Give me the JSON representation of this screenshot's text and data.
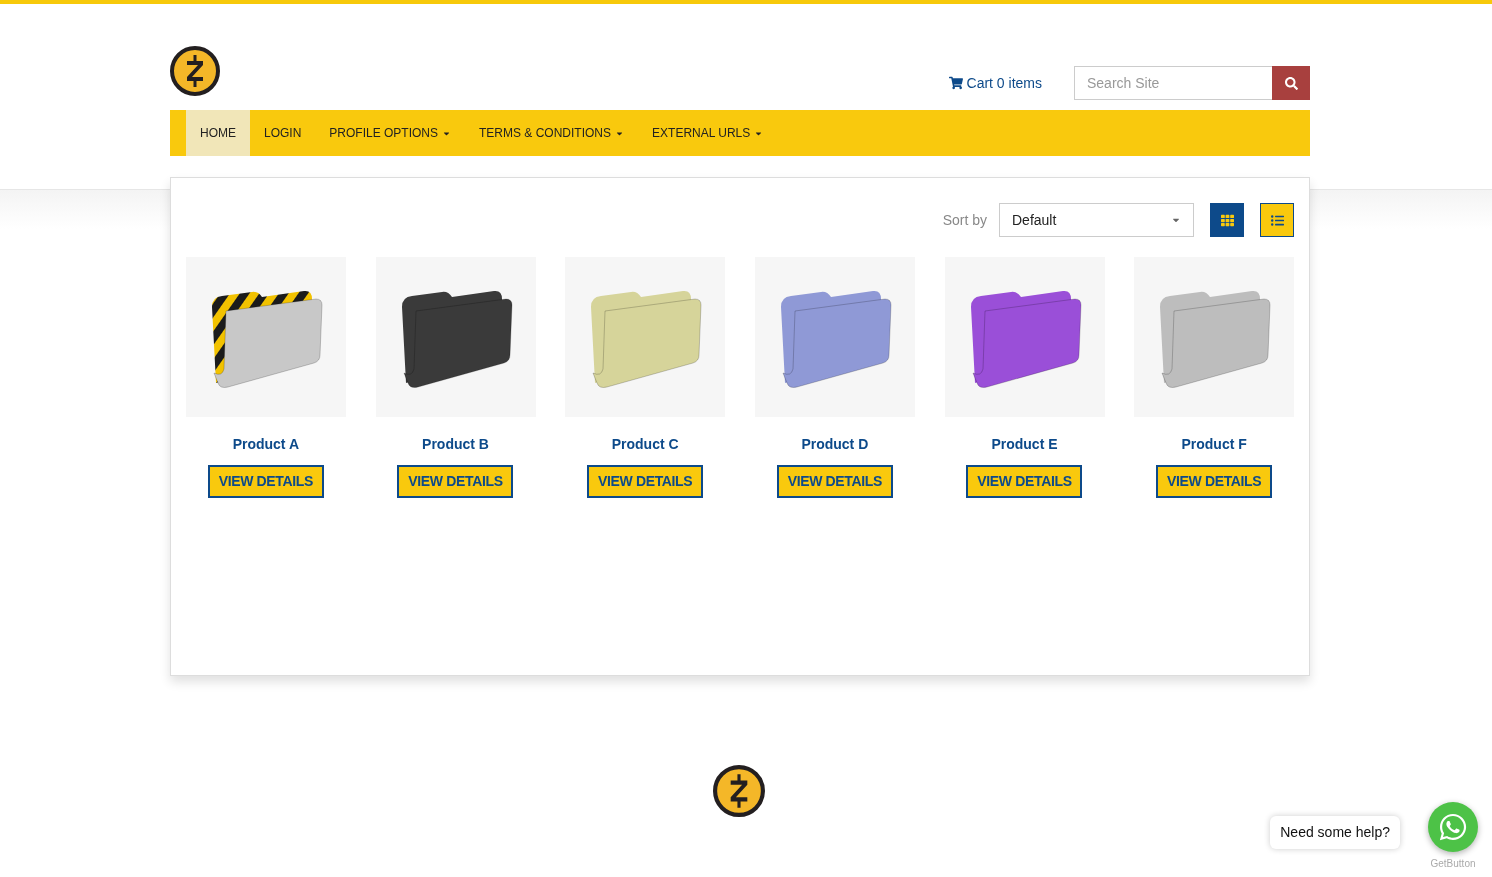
{
  "header": {
    "cart": "Cart 0 items",
    "search": {
      "placeholder": "Search Site"
    }
  },
  "nav": [
    {
      "label": "HOME",
      "selected": true,
      "dropdown": false
    },
    {
      "label": "LOGIN",
      "selected": false,
      "dropdown": false
    },
    {
      "label": "PROFILE OPTIONS",
      "selected": false,
      "dropdown": true
    },
    {
      "label": "TERMS & CONDITIONS",
      "selected": false,
      "dropdown": true
    },
    {
      "label": "EXTERNAL URLS",
      "selected": false,
      "dropdown": true
    }
  ],
  "toolbar": {
    "sort_label": "Sort by",
    "sort_value": "Default",
    "views": [
      {
        "kind": "grid",
        "selected": true
      },
      {
        "kind": "list",
        "selected": false
      }
    ]
  },
  "products": [
    {
      "name": "Product A",
      "kind": "striped",
      "color": "#c8c8c8",
      "button": "VIEW DETAILS"
    },
    {
      "name": "Product B",
      "kind": "plain",
      "color": "#3a3a3a",
      "button": "VIEW DETAILS"
    },
    {
      "name": "Product C",
      "kind": "plain",
      "color": "#d6d49a",
      "button": "VIEW DETAILS"
    },
    {
      "name": "Product D",
      "kind": "plain",
      "color": "#8f99d6",
      "button": "VIEW DETAILS"
    },
    {
      "name": "Product E",
      "kind": "plain",
      "color": "#9a4fd8",
      "button": "VIEW DETAILS"
    },
    {
      "name": "Product F",
      "kind": "plain",
      "color": "#bdbdbd",
      "button": "VIEW DETAILS"
    }
  ],
  "help": {
    "bubble": "Need some help?",
    "caption": "GetButton"
  }
}
